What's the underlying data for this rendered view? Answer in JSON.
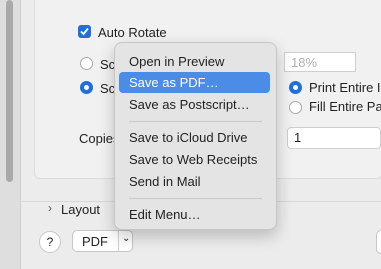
{
  "options": {
    "auto_rotate": "Auto Rotate",
    "scale_option_1": "Sc",
    "scale_option_2": "Sc",
    "scale_value": "18%",
    "print_entire": "Print Entire I",
    "fill_entire": "Fill Entire Pa",
    "copies_label": "Copies",
    "copies_value": "1"
  },
  "layout_section": "Layout",
  "footer": {
    "help_label": "?",
    "pdf_label": "PDF",
    "pdf_chevron": "⌄"
  },
  "pdf_menu": {
    "items": [
      "Open in Preview",
      "Save as PDF…",
      "Save as Postscript…",
      "Save to iCloud Drive",
      "Save to Web Receipts",
      "Send in Mail",
      "Edit Menu…"
    ],
    "highlight_color": "#4a8ce6"
  }
}
